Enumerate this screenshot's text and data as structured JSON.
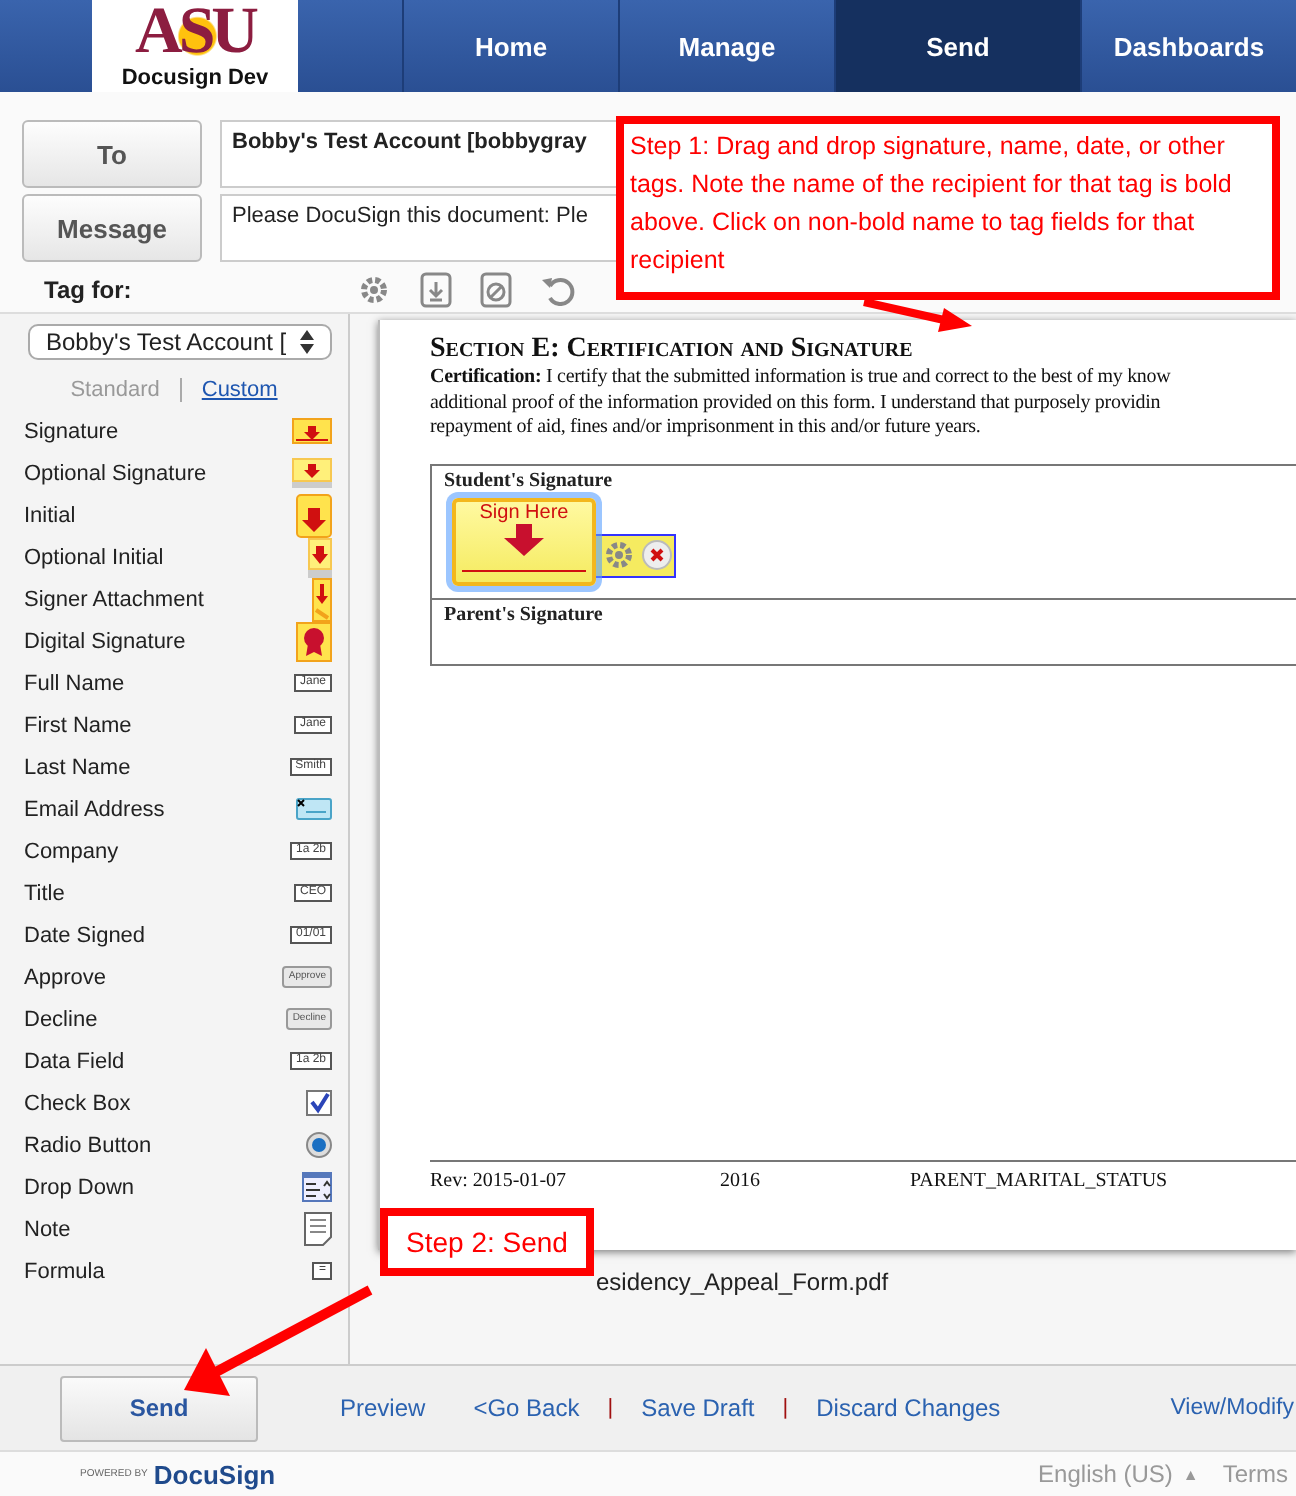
{
  "header": {
    "logo": {
      "letters": "ASU",
      "caption": "Docusign Dev"
    },
    "nav": [
      {
        "label": "Home",
        "selected": false
      },
      {
        "label": "Manage",
        "selected": false
      },
      {
        "label": "Send",
        "selected": true
      },
      {
        "label": "Dashboards",
        "selected": false
      }
    ]
  },
  "compose": {
    "to": {
      "button": "To",
      "value": "Bobby's Test Account [bobbygray"
    },
    "message": {
      "button": "Message",
      "value": "Please DocuSign this document: Ple"
    },
    "tag_for": "Tag for:"
  },
  "sidebar": {
    "recipient": "Bobby's Test Account [",
    "views": [
      {
        "label": "Standard",
        "selected": true
      },
      {
        "label": "Custom",
        "selected": false
      }
    ],
    "tags": [
      {
        "label": "Signature",
        "kind": "signature"
      },
      {
        "label": "Optional Signature",
        "kind": "optional-signature"
      },
      {
        "label": "Initial",
        "kind": "initial"
      },
      {
        "label": "Optional Initial",
        "kind": "optional-initial"
      },
      {
        "label": "Signer Attachment",
        "kind": "attachment"
      },
      {
        "label": "Digital Signature",
        "kind": "seal"
      },
      {
        "label": "Full Name",
        "kind": "text",
        "icon_text": "Jane"
      },
      {
        "label": "First Name",
        "kind": "text",
        "icon_text": "Jane"
      },
      {
        "label": "Last Name",
        "kind": "text",
        "icon_text": "Smith"
      },
      {
        "label": "Email Address",
        "kind": "email"
      },
      {
        "label": "Company",
        "kind": "text",
        "icon_text": "1a 2b"
      },
      {
        "label": "Title",
        "kind": "text",
        "icon_text": "CEO"
      },
      {
        "label": "Date Signed",
        "kind": "text",
        "icon_text": "01/01"
      },
      {
        "label": "Approve",
        "kind": "button",
        "icon_text": "Approve"
      },
      {
        "label": "Decline",
        "kind": "button",
        "icon_text": "Decline"
      },
      {
        "label": "Data Field",
        "kind": "text",
        "icon_text": "1a 2b"
      },
      {
        "label": "Check Box",
        "kind": "checkbox"
      },
      {
        "label": "Radio Button",
        "kind": "radio"
      },
      {
        "label": "Drop Down",
        "kind": "dropdown"
      },
      {
        "label": "Note",
        "kind": "note"
      },
      {
        "label": "Formula",
        "kind": "text",
        "icon_text": "="
      }
    ]
  },
  "document": {
    "heading": "Section E: Certification and Signature",
    "paragraph_lines": [
      "**Certification:** I certify that the submitted information is true and correct to the best of my know",
      "additional proof of the information provided on this form. I understand that purposely providin",
      "repayment of aid, fines and/or imprisonment in this and/or future years."
    ],
    "signature_rows": [
      "Student's Signature",
      "Parent's Signature"
    ],
    "placed_tag": {
      "label": "Sign Here"
    },
    "footer": [
      "Rev: 2015-01-07",
      "2016",
      "PARENT_MARITAL_STATUS"
    ],
    "filename": "esidency_Appeal_Form.pdf"
  },
  "actions": {
    "send": "Send",
    "links": [
      {
        "label": "Preview",
        "kind": "link"
      },
      {
        "label": "<Go Back",
        "kind": "link"
      },
      {
        "label": "|",
        "kind": "separator"
      },
      {
        "label": "Save Draft",
        "kind": "link"
      },
      {
        "label": "|",
        "kind": "separator"
      },
      {
        "label": "Discard Changes",
        "kind": "link"
      },
      {
        "label": "View/Modify",
        "kind": "link"
      }
    ]
  },
  "footer": {
    "powered_by": "POWERED BY",
    "brand": "DocuSign",
    "language": "English (US)",
    "language_caret": "▲",
    "terms": "Terms"
  },
  "callouts": [
    {
      "text": "Step 1: Drag and drop signature, name, date, or other tags.  Note the name of the recipient for that tag is bold above.  Click on non-bold name to tag fields for that recipient"
    },
    {
      "text": "Step 2: Send"
    }
  ]
}
